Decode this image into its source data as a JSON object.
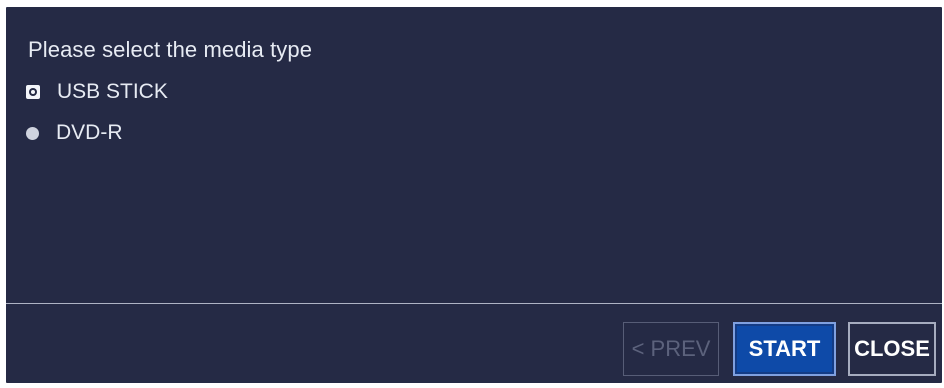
{
  "dialog": {
    "prompt": "Please select the media type",
    "options": [
      {
        "label": "USB STICK",
        "selected": true
      },
      {
        "label": "DVD-R",
        "selected": false
      }
    ]
  },
  "buttons": {
    "prev_label": "< PREV",
    "start_label": "START",
    "close_label": "CLOSE"
  },
  "colors": {
    "background": "#252a45",
    "start_button": "#0e4aa8",
    "text": "#e7ebf3"
  }
}
